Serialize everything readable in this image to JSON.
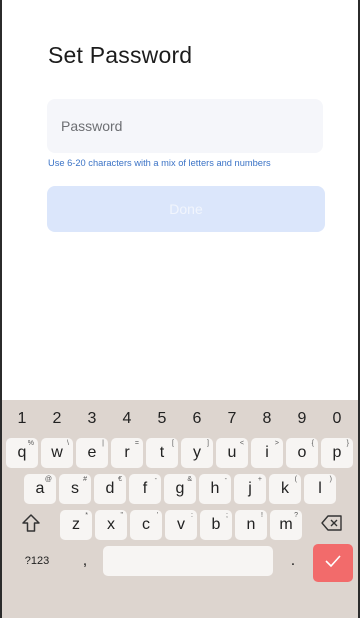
{
  "title": "Set Password",
  "password_field": {
    "placeholder": "Password",
    "value": ""
  },
  "hint": "Use 6-20 characters with a mix of letters and numbers",
  "done_button": "Done",
  "keyboard": {
    "numbers": [
      "1",
      "2",
      "3",
      "4",
      "5",
      "6",
      "7",
      "8",
      "9",
      "0"
    ],
    "row1": [
      {
        "k": "q",
        "s": "%"
      },
      {
        "k": "w",
        "s": "\\"
      },
      {
        "k": "e",
        "s": "|"
      },
      {
        "k": "r",
        "s": "="
      },
      {
        "k": "t",
        "s": "["
      },
      {
        "k": "y",
        "s": "]"
      },
      {
        "k": "u",
        "s": "<"
      },
      {
        "k": "i",
        "s": ">"
      },
      {
        "k": "o",
        "s": "{"
      },
      {
        "k": "p",
        "s": "}"
      }
    ],
    "row2": [
      {
        "k": "a",
        "s": "@"
      },
      {
        "k": "s",
        "s": "#"
      },
      {
        "k": "d",
        "s": "€"
      },
      {
        "k": "f",
        "s": "-"
      },
      {
        "k": "g",
        "s": "&"
      },
      {
        "k": "h",
        "s": "-"
      },
      {
        "k": "j",
        "s": "+"
      },
      {
        "k": "k",
        "s": "("
      },
      {
        "k": "l",
        "s": ")"
      }
    ],
    "row3": [
      {
        "k": "z",
        "s": "*"
      },
      {
        "k": "x",
        "s": "\""
      },
      {
        "k": "c",
        "s": "'"
      },
      {
        "k": "v",
        "s": ":"
      },
      {
        "k": "b",
        "s": ";"
      },
      {
        "k": "n",
        "s": "!"
      },
      {
        "k": "m",
        "s": "?"
      }
    ],
    "shift_icon": "shift-icon",
    "backspace_icon": "backspace-icon",
    "symbols_label": "?123",
    "comma": ",",
    "period": ".",
    "enter_icon": "check-icon",
    "accent_color": "#f26b6b"
  }
}
